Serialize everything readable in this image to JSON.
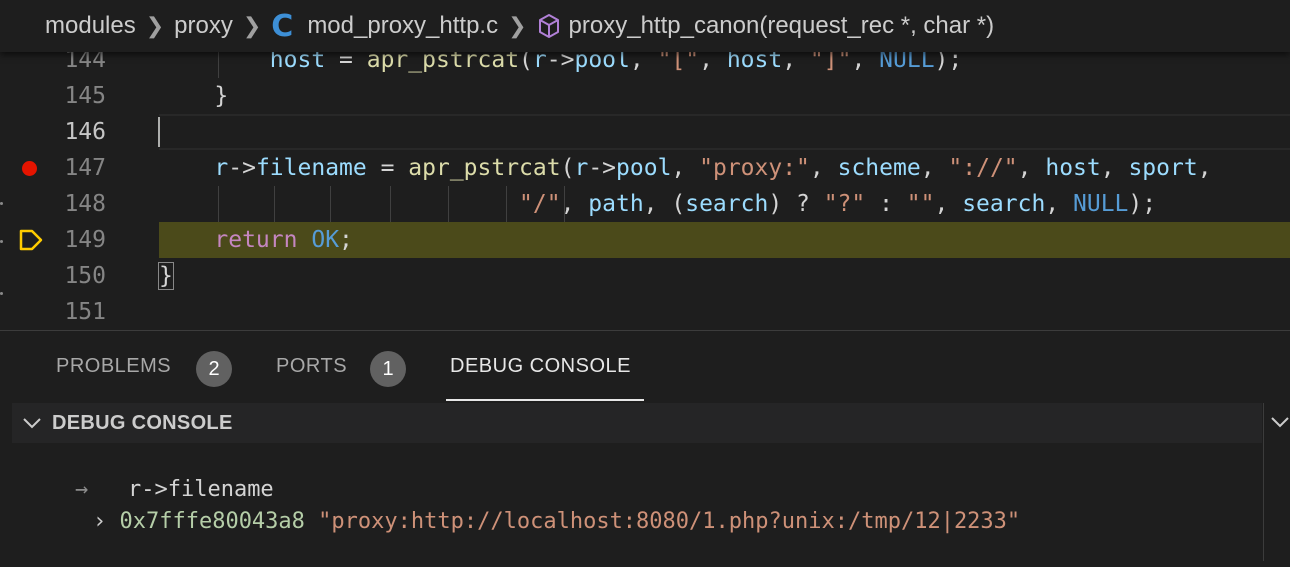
{
  "breadcrumb": {
    "segments": [
      "modules",
      "proxy"
    ],
    "file_icon": "C",
    "file_name": "mod_proxy_http.c",
    "symbol_icon": "cube-icon",
    "symbol": "proxy_http_canon(request_rec *, char *)"
  },
  "editor": {
    "line_numbers": [
      "144",
      "145",
      "146",
      "147",
      "148",
      "149",
      "150",
      "151"
    ],
    "breakpoint_line": "147",
    "current_exec_line": "149",
    "active_line": "146",
    "code": {
      "l144": {
        "indent": "        ",
        "t1": "host",
        "t2": " = ",
        "t3": "apr_pstrcat",
        "t4": "(",
        "t5": "r",
        "t6": "->",
        "t7": "pool",
        "t8": ", ",
        "t9": "\"[\"",
        "t10": ", ",
        "t11": "host",
        "t12": ", ",
        "t13": "\"]\"",
        "t14": ", ",
        "t15": "NULL",
        "t16": ");"
      },
      "l145": {
        "text": "    }"
      },
      "l147": {
        "indent": "    ",
        "t1": "r",
        "t2": "->",
        "t3": "filename",
        "t4": " = ",
        "t5": "apr_pstrcat",
        "t6": "(",
        "t7": "r",
        "t8": "->",
        "t9": "pool",
        "t10": ", ",
        "t11": "\"proxy:\"",
        "t12": ", ",
        "t13": "scheme",
        "t14": ", ",
        "t15": "\"://\"",
        "t16": ", ",
        "t17": "host",
        "t18": ", ",
        "t19": "sport",
        "t20": ","
      },
      "l148": {
        "indent": "                          ",
        "t1": "\"/\"",
        "t2": ", ",
        "t3": "path",
        "t4": ", (",
        "t5": "search",
        "t6": ") ? ",
        "t7": "\"?\"",
        "t8": " : ",
        "t9": "\"\"",
        "t10": ", ",
        "t11": "search",
        "t12": ", ",
        "t13": "NULL",
        "t14": ");"
      },
      "l149": {
        "indent": "    ",
        "t1": "return",
        "t2": " ",
        "t3": "OK",
        "t4": ";"
      },
      "l150": {
        "text": "}"
      }
    }
  },
  "panel": {
    "tabs": [
      {
        "label": "PROBLEMS",
        "badge": "2"
      },
      {
        "label": "PORTS",
        "badge": "1"
      },
      {
        "label": "DEBUG CONSOLE"
      }
    ],
    "active_tab": "DEBUG CONSOLE",
    "console_title": "DEBUG CONSOLE",
    "console": {
      "input_prompt": "→",
      "input_expr": "r->filename",
      "output_expander": "›",
      "output_address": "0x7fffe80043a8",
      "output_value": "\"proxy:http://localhost:8080/1.php?unix:/tmp/12|2233\""
    }
  },
  "colors": {
    "background": "#1e1e1e",
    "current_line_highlight": "#4b4a1a",
    "breakpoint": "#e51400",
    "debug_arrow": "#ffcc00",
    "c_icon": "#3d8fd6",
    "symbol_icon": "#b180d7"
  }
}
